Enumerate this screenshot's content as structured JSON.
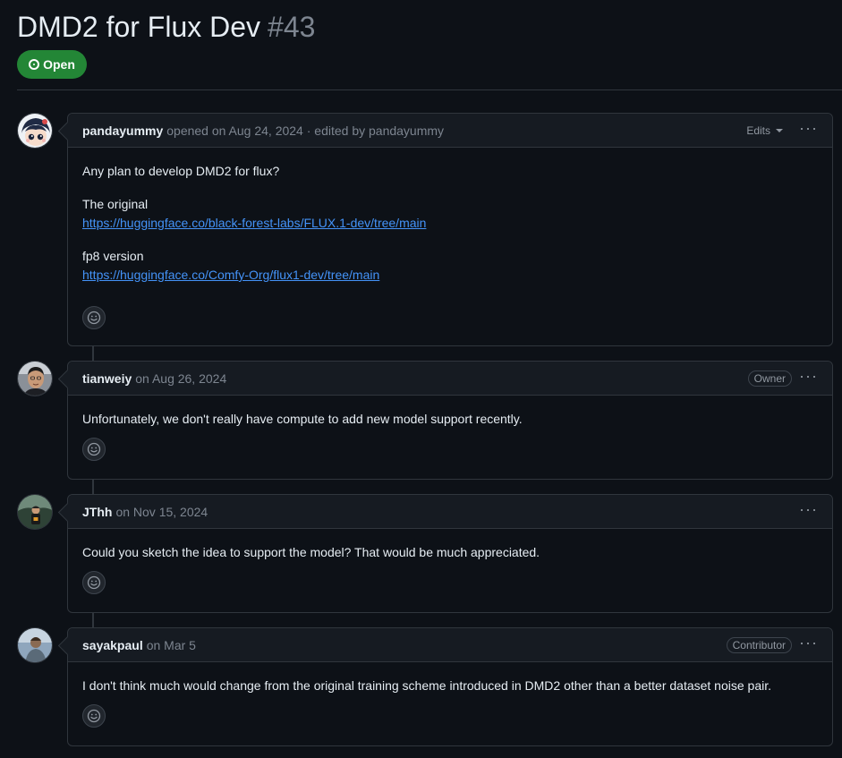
{
  "issue": {
    "title": "DMD2 for Flux Dev",
    "number": "#43",
    "state": "Open"
  },
  "comments": [
    {
      "author": "pandayummy",
      "meta": "opened on Aug 24, 2024 · edited by pandayummy",
      "edits_label": "Edits",
      "body": {
        "line1": "Any plan to develop DMD2 for flux?",
        "line2": "The original",
        "link1": "https://huggingface.co/black-forest-labs/FLUX.1-dev/tree/main",
        "line3": "fp8 version",
        "link2": "https://huggingface.co/Comfy-Org/flux1-dev/tree/main"
      }
    },
    {
      "author": "tianweiy",
      "meta": "on Aug 26, 2024",
      "badge": "Owner",
      "body": "Unfortunately, we don't really have compute to add new model support recently."
    },
    {
      "author": "JThh",
      "meta": "on Nov 15, 2024",
      "body": "Could you sketch the idea to support the model? That would be much appreciated."
    },
    {
      "author": "sayakpaul",
      "meta": "on Mar 5",
      "badge": "Contributor",
      "body": "I don't think much would change from the original training scheme introduced in DMD2 other than a better dataset noise pair."
    }
  ],
  "icons": {
    "more": "kebab-horizontal-icon",
    "reaction": "smiley-icon",
    "state": "issue-opened-icon"
  },
  "colors": {
    "background": "#0d1117",
    "header_bg": "#161b22",
    "border": "#30363d",
    "open_green": "#238636",
    "link": "#4493f8",
    "muted": "#7d8590"
  }
}
